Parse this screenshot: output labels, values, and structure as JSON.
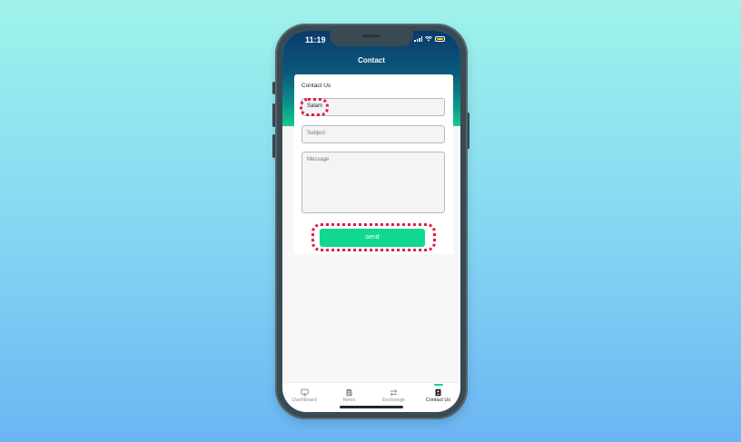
{
  "status_bar": {
    "time": "11:19"
  },
  "header": {
    "title": "Contact"
  },
  "form": {
    "title": "Contact Us",
    "name_value": "Salam",
    "subject_placeholder": "Subject",
    "message_placeholder": "Message",
    "send_label": "send"
  },
  "tabs": [
    {
      "label": "Dashboard",
      "icon": "monitor-icon"
    },
    {
      "label": "News",
      "icon": "news-icon"
    },
    {
      "label": "Exchange",
      "icon": "exchange-icon"
    },
    {
      "label": "Contact Us",
      "icon": "contact-icon"
    }
  ],
  "colors": {
    "accent": "#10d891",
    "highlight": "#e01e3c",
    "header_top": "#0b3a6a"
  }
}
